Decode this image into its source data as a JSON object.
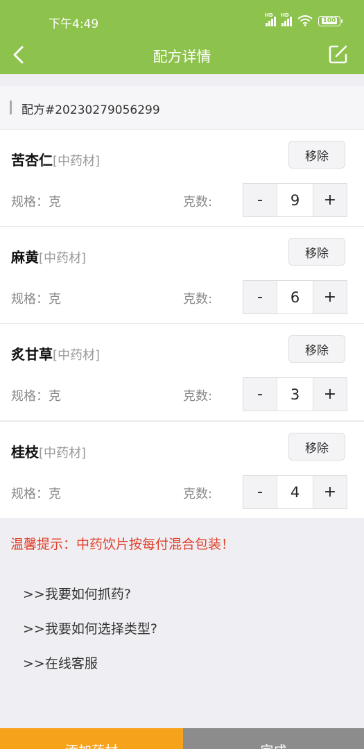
{
  "status_bar": {
    "time": "下午4:49",
    "battery": "100"
  },
  "nav": {
    "title": "配方详情"
  },
  "formula": {
    "label": "配方#20230279056299"
  },
  "herbs": [
    {
      "name": "苦杏仁",
      "type": "[中药材]",
      "remove": "移除",
      "spec": "规格：克",
      "count_label": "克数:",
      "qty": "9"
    },
    {
      "name": "麻黄",
      "type": "[中药材]",
      "remove": "移除",
      "spec": "规格：克",
      "count_label": "克数:",
      "qty": "6"
    },
    {
      "name": "炙甘草",
      "type": "[中药材]",
      "remove": "移除",
      "spec": "规格：克",
      "count_label": "克数:",
      "qty": "3"
    },
    {
      "name": "桂枝",
      "type": "[中药材]",
      "remove": "移除",
      "spec": "规格：克",
      "count_label": "克数:",
      "qty": "4"
    }
  ],
  "stepper": {
    "minus": "-",
    "plus": "+"
  },
  "tip": "温馨提示：中药饮片按每付混合包装！",
  "links": [
    ">>我要如何抓药?",
    ">>我要如何选择类型?",
    ">>在线客服"
  ],
  "bottom": {
    "add": "添加药材",
    "done": "完成"
  }
}
